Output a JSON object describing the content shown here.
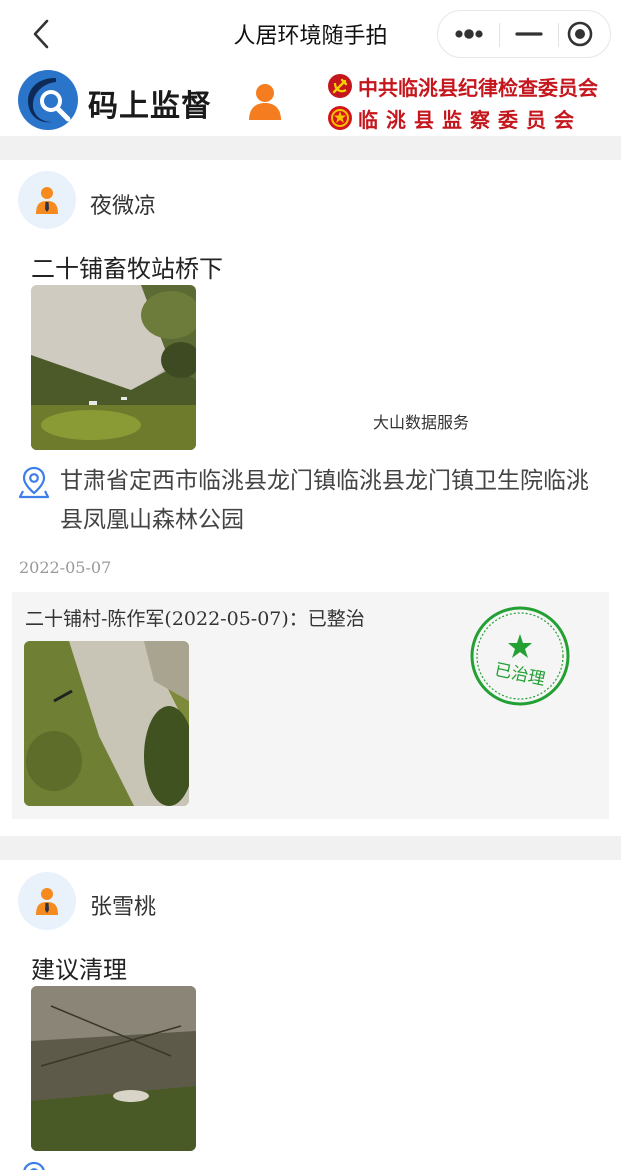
{
  "navbar": {
    "title": "人居环境随手拍",
    "back_icon": "chevron-left-icon",
    "more_icon": "more-dots-icon",
    "minimize_icon": "minimize-icon",
    "close_icon": "target-close-icon"
  },
  "brand": {
    "app_name": "码上监督",
    "org_line1": "中共临洮县纪律检查委员会",
    "org_line2": "临洮县监察委员会",
    "accent_color": "#c4161c",
    "user_icon_color": "#f57c1f"
  },
  "posts": [
    {
      "author": "夜微凉",
      "text": "二十铺畜牧站桥下",
      "watermark": "大山数据服务",
      "location": "甘肃省定西市临洮县龙门镇临洮县龙门镇卫生院临洮县凤凰山森林公园",
      "date": "2022-05-07",
      "reply": {
        "text": "二十铺村-陈作军(2022-05-07)：已整治",
        "stamp_text": "已治理",
        "stamp_color": "#22a033"
      }
    },
    {
      "author": "张雪桃",
      "text": "建议清理"
    }
  ]
}
